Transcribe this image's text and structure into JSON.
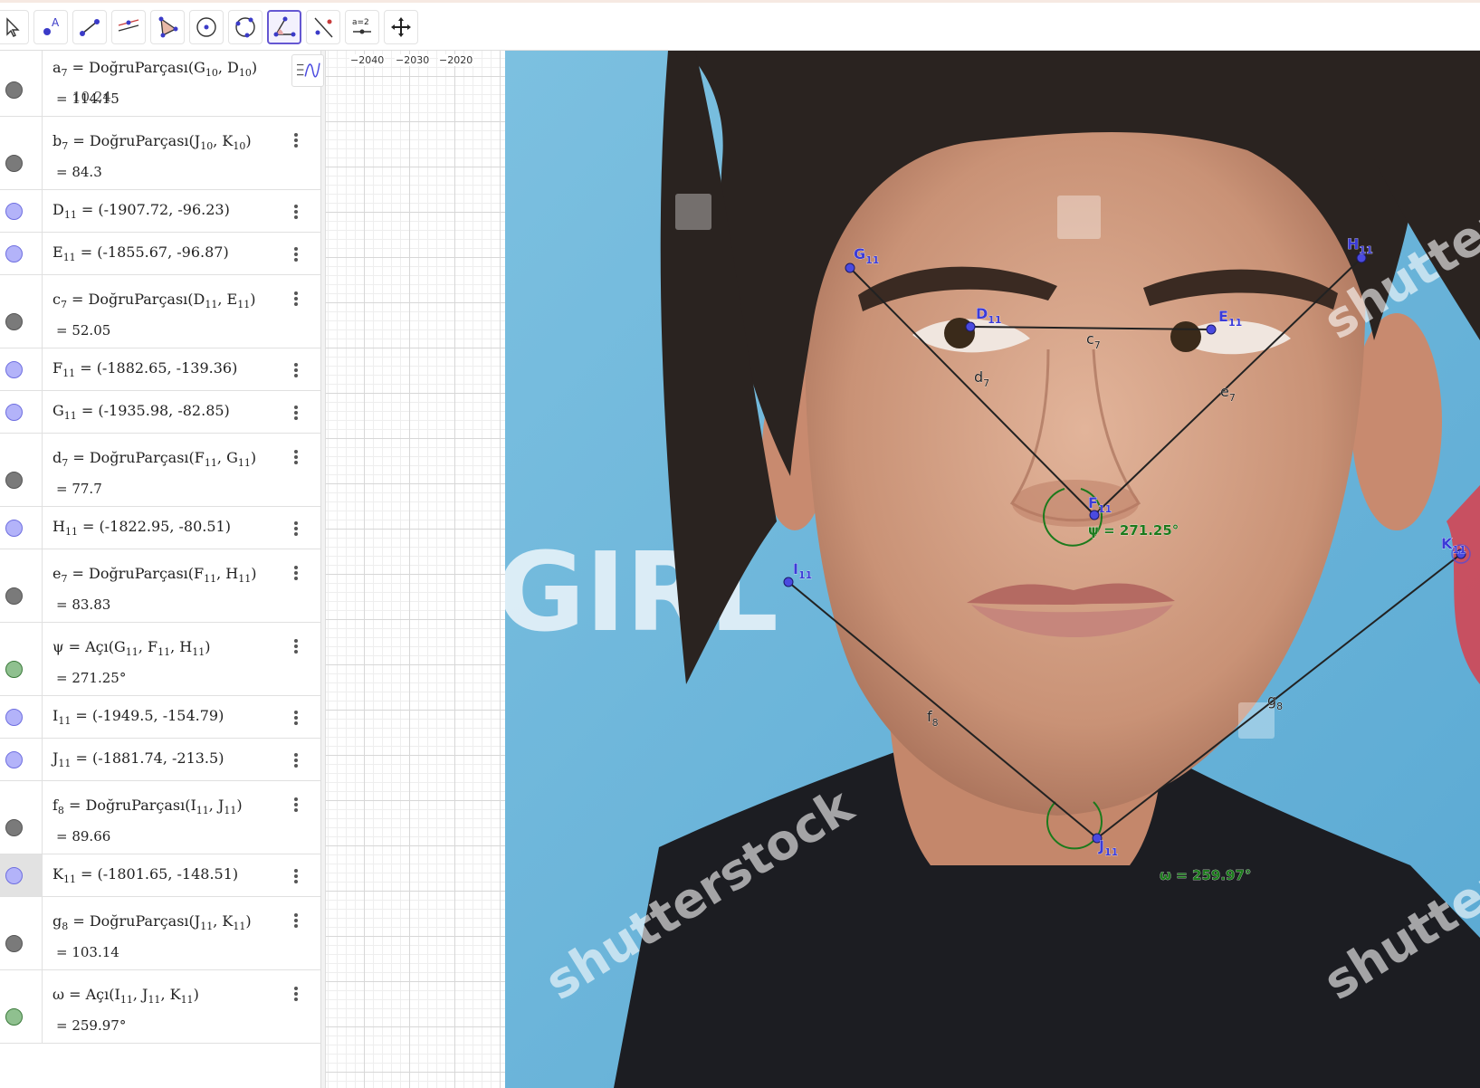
{
  "toolbar": {
    "tools": [
      "move-tool",
      "point-tool",
      "segment-tool",
      "perpendicular-line-tool",
      "polygon-tool",
      "circle-center-tool",
      "circle-three-points-tool",
      "angle-tool",
      "reflect-tool",
      "slider-tool",
      "move-graphics-tool"
    ],
    "slider_label": "a=2",
    "active_tool": "angle-tool"
  },
  "algebra": {
    "top_cut_value": "10.24",
    "rows": [
      {
        "type": "seg",
        "color": "gray",
        "name": "a",
        "sub": "7",
        "cmd": "DoğruParçası",
        "args": [
          [
            "G",
            "10"
          ],
          [
            "D",
            "10"
          ]
        ],
        "value": "114.15"
      },
      {
        "type": "seg",
        "color": "gray",
        "name": "b",
        "sub": "7",
        "cmd": "DoğruParçası",
        "args": [
          [
            "J",
            "10"
          ],
          [
            "K",
            "10"
          ]
        ],
        "value": "84.3"
      },
      {
        "type": "pt",
        "color": "blue",
        "name": "D",
        "sub": "11",
        "coords": "(-1907.72, -96.23)"
      },
      {
        "type": "pt",
        "color": "blue",
        "name": "E",
        "sub": "11",
        "coords": "(-1855.67, -96.87)"
      },
      {
        "type": "seg",
        "color": "gray",
        "name": "c",
        "sub": "7",
        "cmd": "DoğruParçası",
        "args": [
          [
            "D",
            "11"
          ],
          [
            "E",
            "11"
          ]
        ],
        "value": "52.05"
      },
      {
        "type": "pt",
        "color": "blue",
        "name": "F",
        "sub": "11",
        "coords": "(-1882.65, -139.36)"
      },
      {
        "type": "pt",
        "color": "blue",
        "name": "G",
        "sub": "11",
        "coords": "(-1935.98, -82.85)"
      },
      {
        "type": "seg",
        "color": "gray",
        "name": "d",
        "sub": "7",
        "cmd": "DoğruParçası",
        "args": [
          [
            "F",
            "11"
          ],
          [
            "G",
            "11"
          ]
        ],
        "value": "77.7"
      },
      {
        "type": "pt",
        "color": "blue",
        "name": "H",
        "sub": "11",
        "coords": "(-1822.95, -80.51)"
      },
      {
        "type": "seg",
        "color": "gray",
        "name": "e",
        "sub": "7",
        "cmd": "DoğruParçası",
        "args": [
          [
            "F",
            "11"
          ],
          [
            "H",
            "11"
          ]
        ],
        "value": "83.83"
      },
      {
        "type": "seg",
        "color": "green",
        "name": "ψ",
        "sub": "",
        "cmd": "Açı",
        "args": [
          [
            "G",
            "11"
          ],
          [
            "F",
            "11"
          ],
          [
            "H",
            "11"
          ]
        ],
        "value": "271.25°"
      },
      {
        "type": "pt",
        "color": "blue",
        "name": "I",
        "sub": "11",
        "coords": "(-1949.5, -154.79)"
      },
      {
        "type": "pt",
        "color": "blue",
        "name": "J",
        "sub": "11",
        "coords": "(-1881.74, -213.5)"
      },
      {
        "type": "seg",
        "color": "gray",
        "name": "f",
        "sub": "8",
        "cmd": "DoğruParçası",
        "args": [
          [
            "I",
            "11"
          ],
          [
            "J",
            "11"
          ]
        ],
        "value": "89.66"
      },
      {
        "type": "pt",
        "color": "blue",
        "name": "K",
        "sub": "11",
        "coords": "(-1801.65, -148.51)",
        "selected": true
      },
      {
        "type": "seg",
        "color": "gray",
        "name": "g",
        "sub": "8",
        "cmd": "DoğruParçası",
        "args": [
          [
            "J",
            "11"
          ],
          [
            "K",
            "11"
          ]
        ],
        "value": "103.14"
      },
      {
        "type": "seg",
        "color": "green",
        "name": "ω",
        "sub": "",
        "cmd": "Açı",
        "args": [
          [
            "I",
            "11"
          ],
          [
            "J",
            "11"
          ],
          [
            "K",
            "11"
          ]
        ],
        "value": "259.97°"
      }
    ]
  },
  "graphics": {
    "x_ticks": [
      "−2040",
      "−2030",
      "−2020"
    ],
    "background_text": "GIRL",
    "watermark": "shutterstock",
    "accent_color": "#4a4ae0",
    "angle_color": "#1c7a1c",
    "points": [
      {
        "name": "G",
        "sub": "11"
      },
      {
        "name": "H",
        "sub": "11"
      },
      {
        "name": "D",
        "sub": "11"
      },
      {
        "name": "E",
        "sub": "11"
      },
      {
        "name": "F",
        "sub": "11"
      },
      {
        "name": "I",
        "sub": "11"
      },
      {
        "name": "J",
        "sub": "11"
      },
      {
        "name": "K",
        "sub": "11"
      }
    ],
    "segment_labels": [
      {
        "name": "c",
        "sub": "7"
      },
      {
        "name": "d",
        "sub": "7"
      },
      {
        "name": "e",
        "sub": "7"
      },
      {
        "name": "f",
        "sub": "8"
      },
      {
        "name": "g",
        "sub": "8"
      }
    ],
    "angle_labels": [
      "ψ = 271.25°",
      "ω = 259.97°"
    ]
  }
}
